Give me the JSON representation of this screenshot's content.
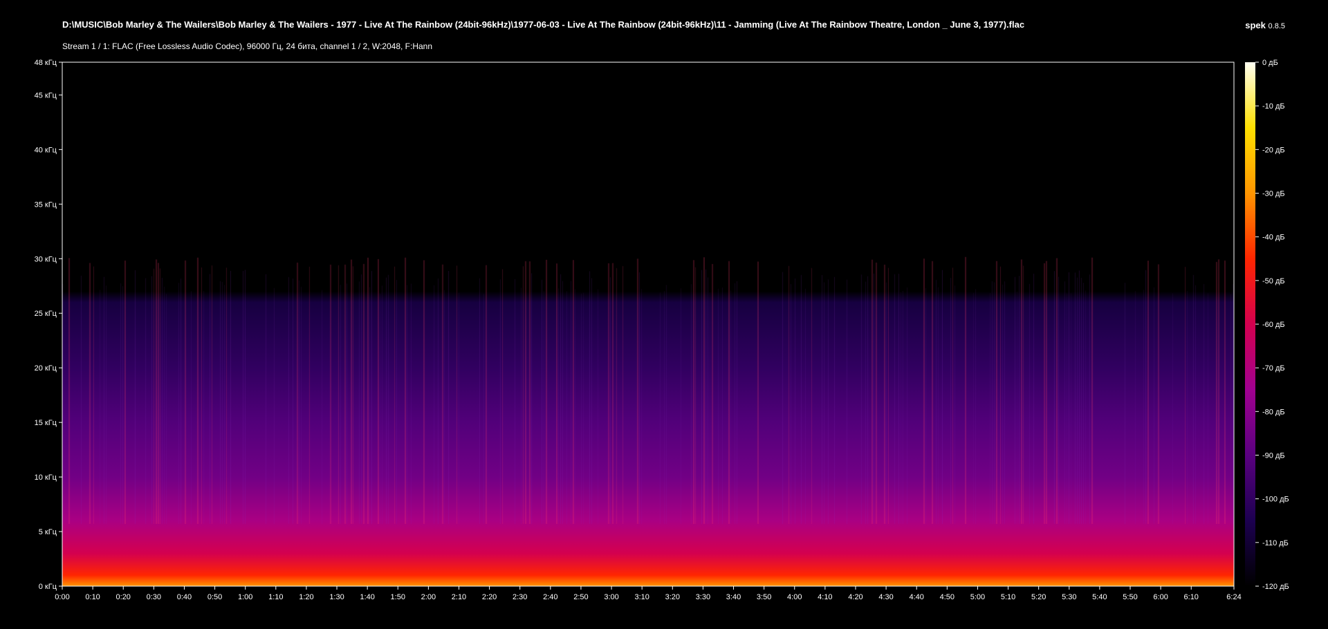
{
  "header": {
    "file_path": "D:\\MUSIC\\Bob Marley & The Wailers\\Bob Marley & The Wailers - 1977 - Live At The Rainbow  (24bit-96kHz)\\1977-06-03 - Live At The Rainbow (24bit-96kHz)\\11 - Jamming (Live At The Rainbow Theatre, London _ June 3, 1977).flac",
    "stream_info": "Stream 1 / 1: FLAC (Free Lossless Audio Codec), 96000 Гц, 24 бита, channel 1 / 2, W:2048, F:Hann",
    "app_name": "spek",
    "app_version": "0.8.5"
  },
  "chart_data": {
    "type": "heatmap",
    "background": "#000000",
    "frame_color": "#ffffff",
    "x_axis": {
      "range": [
        0,
        384
      ],
      "ticks": [
        0,
        10,
        20,
        30,
        40,
        50,
        60,
        70,
        80,
        90,
        100,
        110,
        120,
        130,
        140,
        150,
        160,
        170,
        180,
        190,
        200,
        210,
        220,
        230,
        240,
        250,
        260,
        270,
        280,
        290,
        300,
        310,
        320,
        330,
        340,
        350,
        360,
        370,
        384
      ],
      "tick_labels": [
        "0:00",
        "0:10",
        "0:20",
        "0:30",
        "0:40",
        "0:50",
        "1:00",
        "1:10",
        "1:20",
        "1:30",
        "1:40",
        "1:50",
        "2:00",
        "2:10",
        "2:20",
        "2:30",
        "2:40",
        "2:50",
        "3:00",
        "3:10",
        "3:20",
        "3:30",
        "3:40",
        "3:50",
        "4:00",
        "4:10",
        "4:20",
        "4:30",
        "4:40",
        "4:50",
        "5:00",
        "5:10",
        "5:20",
        "5:30",
        "5:40",
        "5:50",
        "6:00",
        "6:10",
        "6:24"
      ]
    },
    "y_axis": {
      "range": [
        0,
        48
      ],
      "ticks": [
        0,
        5,
        10,
        15,
        20,
        25,
        30,
        35,
        40,
        45,
        48
      ],
      "tick_labels": [
        "0 кГц",
        "5 кГц",
        "10 кГц",
        "15 кГц",
        "20 кГц",
        "25 кГц",
        "30 кГц",
        "35 кГц",
        "40 кГц",
        "45 кГц",
        "48 кГц"
      ]
    },
    "colorbar": {
      "range": [
        -120,
        0
      ],
      "ticks": [
        0,
        -10,
        -20,
        -30,
        -40,
        -50,
        -60,
        -70,
        -80,
        -90,
        -100,
        -110,
        -120
      ],
      "tick_labels": [
        "0 дБ",
        "-10 дБ",
        "-20 дБ",
        "-30 дБ",
        "-40 дБ",
        "-50 дБ",
        "-60 дБ",
        "-70 дБ",
        "-80 дБ",
        "-90 дБ",
        "-100 дБ",
        "-110 дБ",
        "-120 дБ"
      ],
      "colors": [
        "#fffff2",
        "#ffe000",
        "#ff9500",
        "#ff2600",
        "#d4004f",
        "#a00090",
        "#5a0080",
        "#1c0050",
        "#000000"
      ]
    },
    "spectrum": {
      "cutoff_khz": 27,
      "levels": [
        {
          "freq_khz": 0,
          "db": -30
        },
        {
          "freq_khz": 1,
          "db": -45
        },
        {
          "freq_khz": 3,
          "db": -60
        },
        {
          "freq_khz": 6,
          "db": -72
        },
        {
          "freq_khz": 10,
          "db": -85
        },
        {
          "freq_khz": 15,
          "db": -92
        },
        {
          "freq_khz": 20,
          "db": -100
        },
        {
          "freq_khz": 26,
          "db": -108
        },
        {
          "freq_khz": 27,
          "db": -120
        }
      ]
    }
  }
}
